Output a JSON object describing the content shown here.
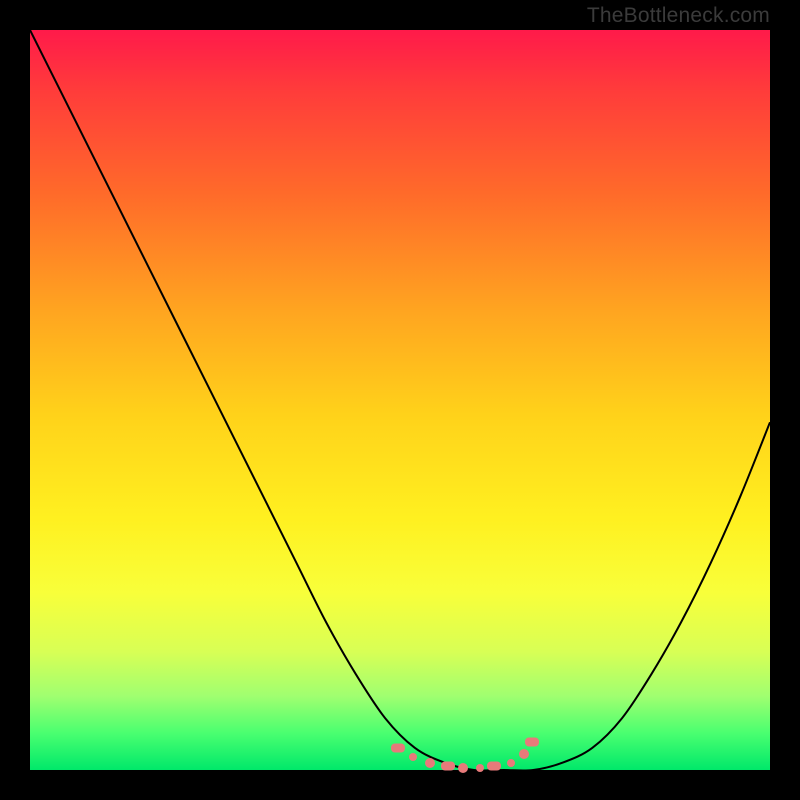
{
  "watermark": "TheBottleneck.com",
  "chart_data": {
    "type": "line",
    "title": "",
    "xlabel": "",
    "ylabel": "",
    "x": [
      0.0,
      0.04,
      0.08,
      0.12,
      0.16,
      0.2,
      0.24,
      0.28,
      0.32,
      0.36,
      0.4,
      0.44,
      0.48,
      0.52,
      0.56,
      0.6,
      0.64,
      0.68,
      0.72,
      0.76,
      0.8,
      0.84,
      0.88,
      0.92,
      0.96,
      1.0
    ],
    "y": [
      1.0,
      0.92,
      0.84,
      0.76,
      0.68,
      0.6,
      0.52,
      0.44,
      0.36,
      0.28,
      0.2,
      0.13,
      0.07,
      0.03,
      0.01,
      0.0,
      0.0,
      0.0,
      0.01,
      0.03,
      0.07,
      0.13,
      0.2,
      0.28,
      0.37,
      0.47
    ],
    "ylim": [
      0,
      1
    ],
    "xlim": [
      0,
      1
    ],
    "markers": {
      "x": [
        0.497,
        0.518,
        0.54,
        0.565,
        0.585,
        0.608,
        0.627,
        0.65,
        0.668,
        0.678
      ],
      "y": [
        0.03,
        0.018,
        0.01,
        0.005,
        0.003,
        0.003,
        0.005,
        0.01,
        0.022,
        0.038
      ]
    },
    "colors": {
      "curve": "#000000",
      "markers": "#e77a7a",
      "gradient_top": "#ff1a4a",
      "gradient_bottom": "#00e86a"
    }
  }
}
